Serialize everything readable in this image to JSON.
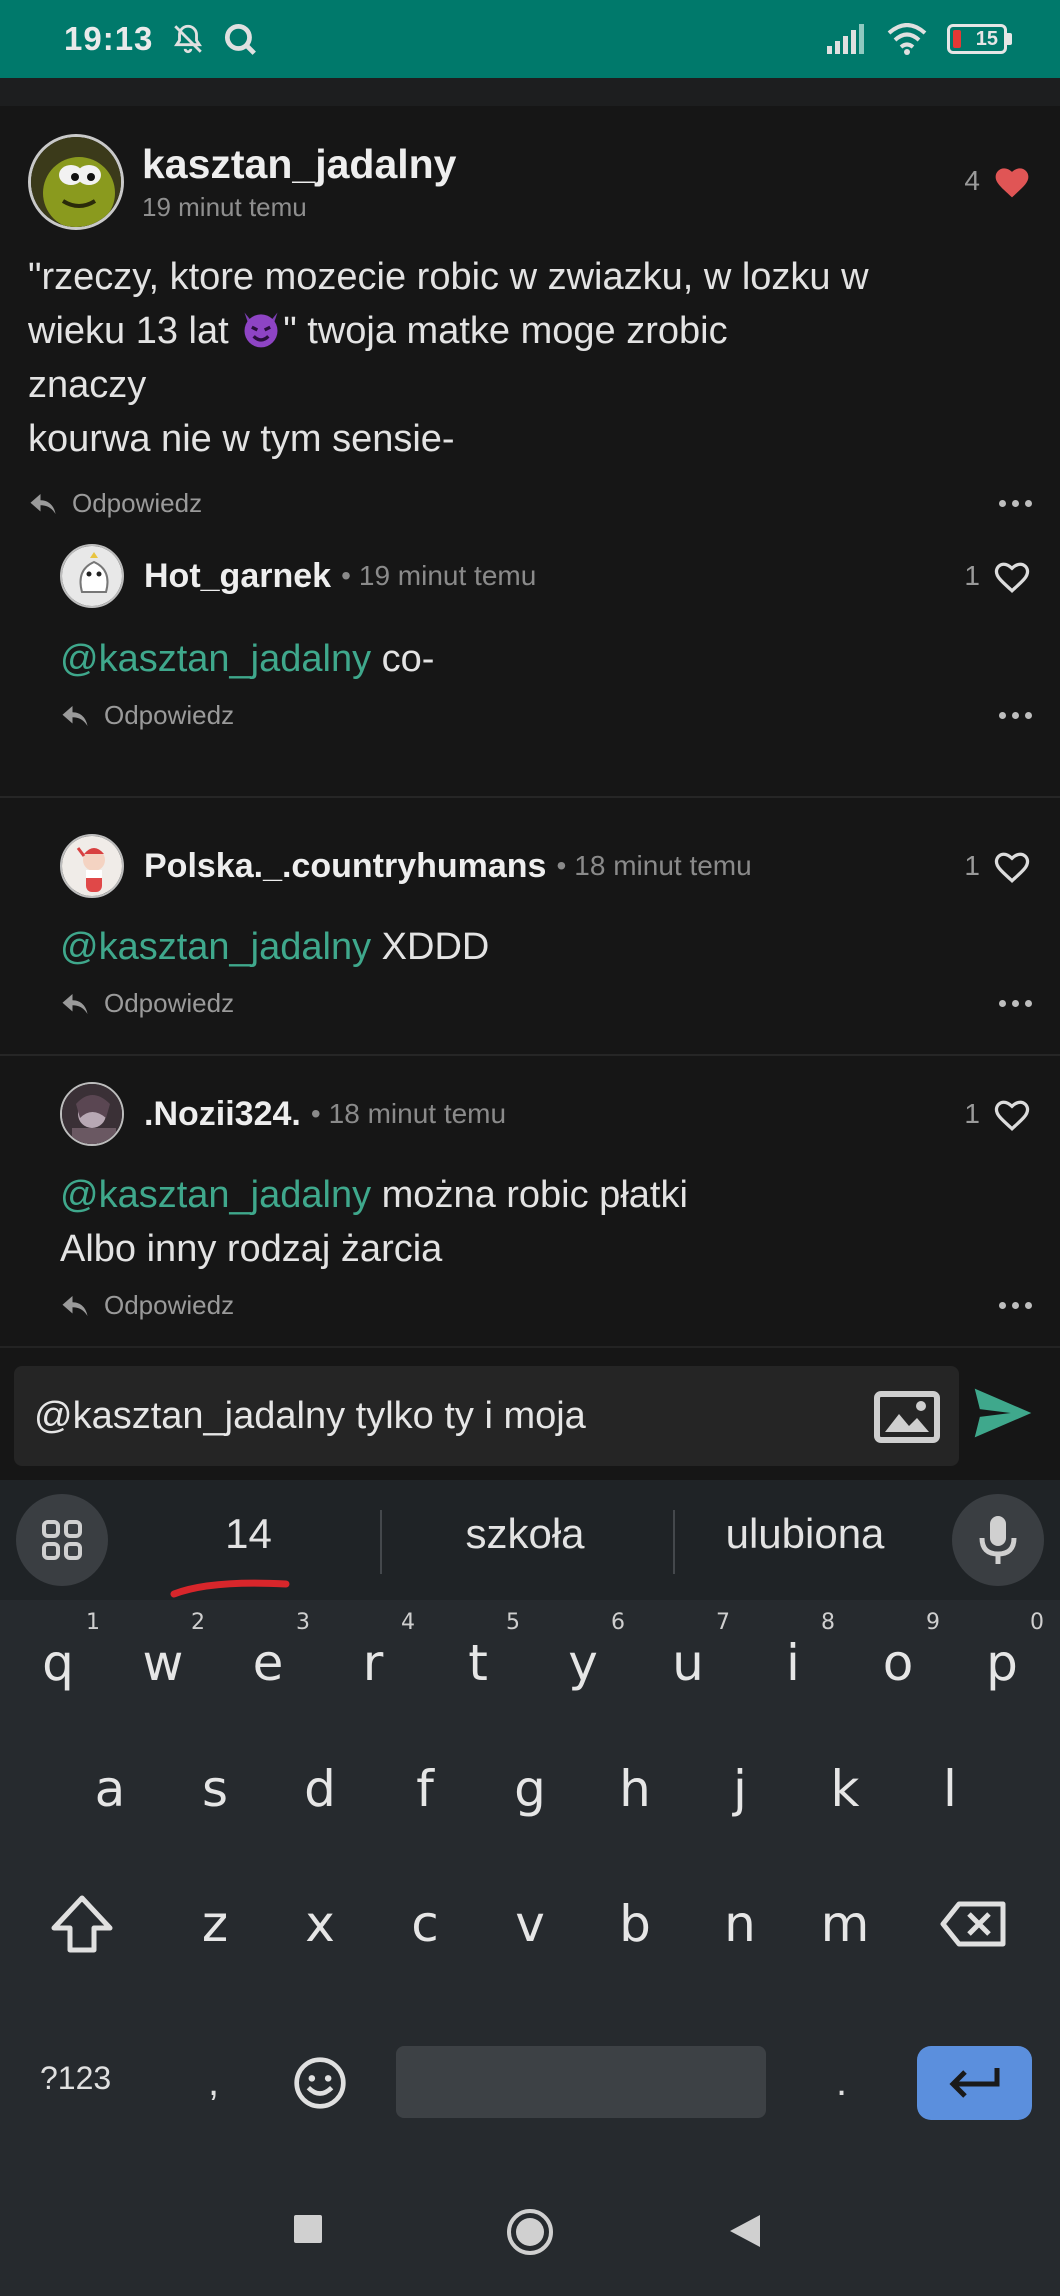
{
  "status_bar": {
    "time": "19:13",
    "battery": "15"
  },
  "main_comment": {
    "author": "kasztan_jadalny",
    "time": "19 minut temu",
    "likes": "4",
    "text_line1": "\"rzeczy, ktore mozecie robic w zwiazku, w lozku w",
    "text_line2_pre": "wieku 13 lat ",
    "text_line2_post": "\" twoja matke moge zrobic",
    "text_line3": "znaczy",
    "text_line4": "kourwa nie w tym sensie-",
    "reply_label": "Odpowiedz"
  },
  "replies": [
    {
      "author": "Hot_garnek",
      "time": "19 minut temu",
      "likes": "1",
      "mention": "@kasztan_jadalny",
      "text": " co-",
      "text2": "",
      "reply_label": "Odpowiedz"
    },
    {
      "author": "Polska._.countryhumans",
      "time": "18 minut temu",
      "likes": "1",
      "mention": "@kasztan_jadalny",
      "text": " XDDD",
      "text2": "",
      "reply_label": "Odpowiedz"
    },
    {
      "author": ".Nozii324.",
      "time": "18 minut temu",
      "likes": "1",
      "mention": "@kasztan_jadalny",
      "text": " można robic płatki",
      "text2": "Albo inny rodzaj żarcia",
      "reply_label": "Odpowiedz"
    }
  ],
  "input": {
    "value": "@kasztan_jadalny tylko ty i moja"
  },
  "keyboard": {
    "suggestions": [
      "14",
      "szkoła",
      "ulubiona"
    ],
    "row1": [
      "q",
      "w",
      "e",
      "r",
      "t",
      "y",
      "u",
      "i",
      "o",
      "p"
    ],
    "row1_numbers": [
      "1",
      "2",
      "3",
      "4",
      "5",
      "6",
      "7",
      "8",
      "9",
      "0"
    ],
    "row2": [
      "a",
      "s",
      "d",
      "f",
      "g",
      "h",
      "j",
      "k",
      "l"
    ],
    "row3": [
      "z",
      "x",
      "c",
      "v",
      "b",
      "n",
      "m"
    ],
    "symbols_key": "?123",
    "comma_key": ",",
    "period_key": "."
  },
  "colors": {
    "accent": "#3fa88c",
    "status_bar": "#00796b",
    "heart_liked": "#e05555",
    "enter_key": "#5b8fdd"
  },
  "icons": [
    "bell-off-icon",
    "search-icon",
    "signal-icon",
    "wifi-icon",
    "battery-icon",
    "heart-icon",
    "reply-icon",
    "more-icon",
    "image-icon",
    "send-icon",
    "apps-icon",
    "mic-icon",
    "shift-icon",
    "backspace-icon",
    "emoji-icon",
    "enter-icon",
    "nav-square-icon",
    "nav-home-icon",
    "nav-back-icon"
  ]
}
